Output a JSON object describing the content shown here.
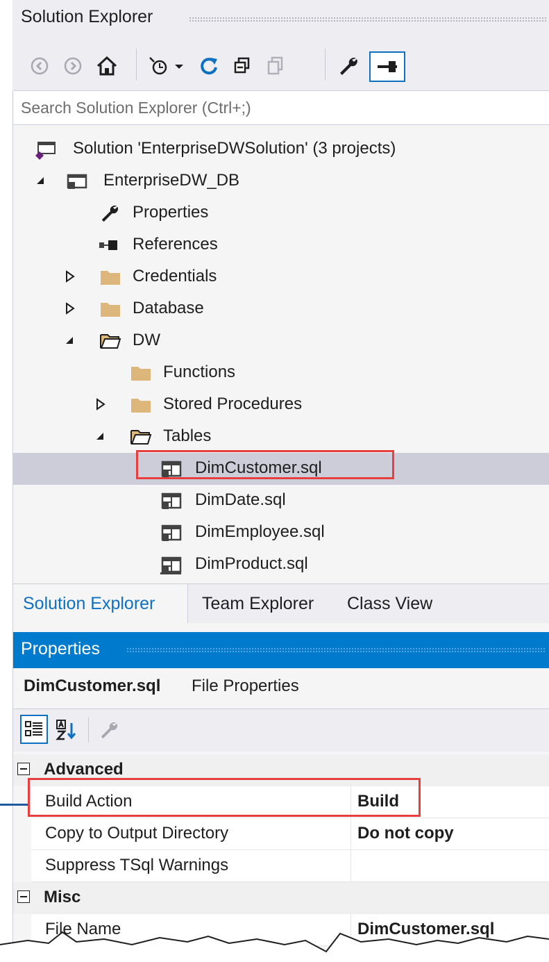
{
  "solution_explorer": {
    "title": "Solution Explorer",
    "search_placeholder": "Search Solution Explorer (Ctrl+;)",
    "toolbar": [
      "back-icon",
      "forward-icon",
      "home-icon",
      "pending-changes-icon",
      "sync-icon",
      "collapse-all-icon",
      "show-all-files-icon",
      "properties-icon",
      "pin-icon"
    ],
    "tree": [
      {
        "label": "Solution 'EnterpriseDWSolution' (3 projects)",
        "icon": "solution-icon",
        "expand": "none",
        "depth": 0
      },
      {
        "label": "EnterpriseDW_DB",
        "icon": "db-project-icon",
        "expand": "expanded",
        "depth": 0
      },
      {
        "label": "Properties",
        "icon": "wrench-icon",
        "expand": "none",
        "depth": 1
      },
      {
        "label": "References",
        "icon": "references-icon",
        "expand": "none",
        "depth": 1
      },
      {
        "label": "Credentials",
        "icon": "folder-icon",
        "expand": "collapsed",
        "depth": 1
      },
      {
        "label": "Database",
        "icon": "folder-icon",
        "expand": "collapsed",
        "depth": 1
      },
      {
        "label": "DW",
        "icon": "folder-open-icon",
        "expand": "expanded",
        "depth": 1
      },
      {
        "label": "Functions",
        "icon": "folder-icon",
        "expand": "none",
        "depth": 2
      },
      {
        "label": "Stored Procedures",
        "icon": "folder-icon",
        "expand": "collapsed",
        "depth": 2
      },
      {
        "label": "Tables",
        "icon": "folder-open-icon",
        "expand": "expanded",
        "depth": 2
      },
      {
        "label": "DimCustomer.sql",
        "icon": "sql-table-icon",
        "expand": "none",
        "depth": 3,
        "selected": true
      },
      {
        "label": "DimDate.sql",
        "icon": "sql-table-icon",
        "expand": "none",
        "depth": 3
      },
      {
        "label": "DimEmployee.sql",
        "icon": "sql-table-icon",
        "expand": "none",
        "depth": 3
      },
      {
        "label": "DimProduct.sql",
        "icon": "sql-table-icon",
        "expand": "none",
        "depth": 3
      }
    ]
  },
  "tabs": [
    {
      "label": "Solution Explorer",
      "active": true
    },
    {
      "label": "Team Explorer",
      "active": false
    },
    {
      "label": "Class View",
      "active": false
    }
  ],
  "properties": {
    "title": "Properties",
    "object_name": "DimCustomer.sql",
    "object_kind": "File Properties",
    "toolbar": [
      "categorized-icon",
      "alphabetical-icon",
      "property-pages-icon"
    ],
    "categories": [
      {
        "name": "Advanced",
        "rows": [
          {
            "name": "Build Action",
            "value": "Build"
          },
          {
            "name": "Copy to Output Directory",
            "value": "Do not copy"
          },
          {
            "name": "Suppress TSql Warnings",
            "value": ""
          }
        ]
      },
      {
        "name": "Misc",
        "rows": [
          {
            "name": "File Name",
            "value": "DimCustomer.sql"
          }
        ]
      }
    ]
  },
  "colors": {
    "accent": "#007acc",
    "highlight_box": "#e53f3f",
    "selected_row": "#cdcdd9",
    "folder": "#dcb67a",
    "active_tab_text": "#0e70c0"
  }
}
